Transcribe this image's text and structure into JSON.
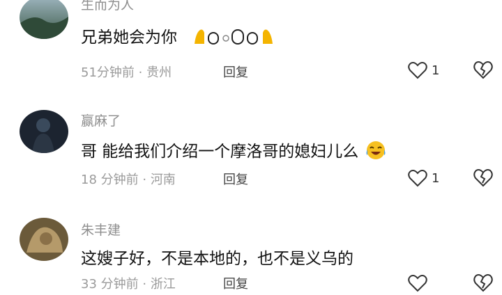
{
  "comments": [
    {
      "username": "生而为人",
      "text": "兄弟她会为你",
      "emoji_desc": "folded-hands emoji sequence",
      "time": "51分钟前",
      "location": "贵州",
      "reply_label": "回复",
      "likes": "1",
      "avatar_colors": [
        "#3c5a48",
        "#7e9a86"
      ]
    },
    {
      "username": "赢麻了",
      "text": "哥 能给我们介绍一个摩洛哥的媳妇儿么",
      "emoji_desc": "crying-laughing emoji",
      "time": "18 分钟前",
      "location": "河南",
      "reply_label": "回复",
      "likes": "1",
      "avatar_colors": [
        "#1c2430",
        "#3a4a5c"
      ]
    },
    {
      "username": "朱丰建",
      "text": "这嫂子好，不是本地的，也不是义乌的",
      "time": "33 分钟前",
      "location": "浙江",
      "reply_label": "回复",
      "likes": "",
      "avatar_colors": [
        "#6b5a3a",
        "#b59a6a"
      ]
    }
  ],
  "meta_separator": " · "
}
